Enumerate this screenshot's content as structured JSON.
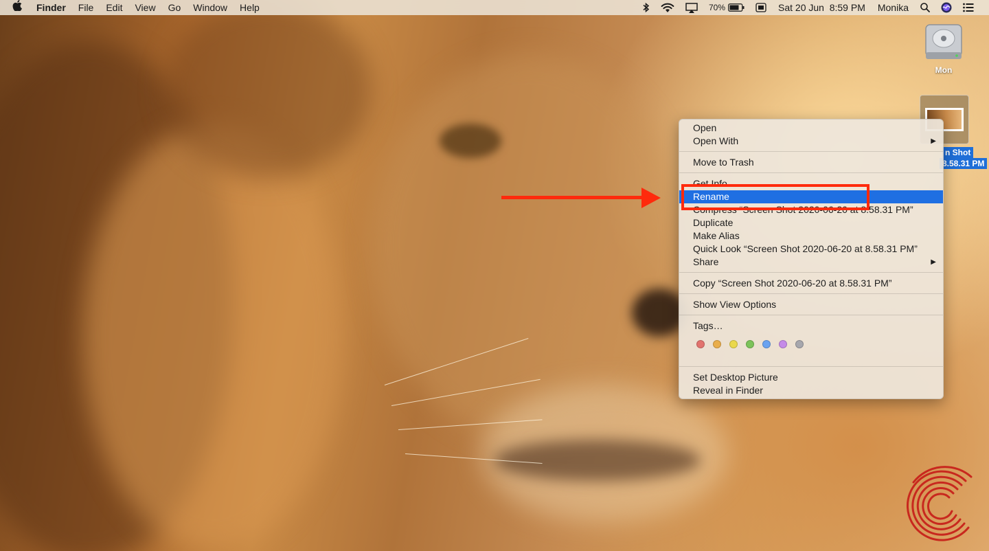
{
  "menubar": {
    "apple_glyph": "",
    "app_name": "Finder",
    "menus": [
      "File",
      "Edit",
      "View",
      "Go",
      "Window",
      "Help"
    ],
    "battery_percent": "70%",
    "datetime": "Sat 20 Jun  8:59 PM",
    "user": "Monika",
    "status_icons": [
      "bluetooth-icon",
      "wifi-icon",
      "airplay-icon",
      "battery-icon",
      "keyboard-icon",
      "spotlight-icon",
      "siri-icon",
      "notification-center-icon"
    ]
  },
  "desktop": {
    "drive_label": "Mon",
    "screenshot_label_line1": "n Shot",
    "screenshot_label_line2": "8.58.31 PM"
  },
  "context_menu": {
    "items": [
      {
        "label": "Open"
      },
      {
        "label": "Open With",
        "submenu": true
      },
      {
        "label": "Move to Trash"
      },
      {
        "label": "Get Info"
      },
      {
        "label": "Rename",
        "selected": true
      },
      {
        "label": "Compress “Screen Shot 2020-06-20 at 8.58.31 PM”"
      },
      {
        "label": "Duplicate"
      },
      {
        "label": "Make Alias"
      },
      {
        "label": "Quick Look “Screen Shot 2020-06-20 at 8.58.31 PM”"
      },
      {
        "label": "Share",
        "submenu": true
      },
      {
        "label": "Copy “Screen Shot 2020-06-20 at 8.58.31 PM”"
      },
      {
        "label": "Show View Options"
      },
      {
        "label": "Tags…"
      },
      {
        "label": "Set Desktop Picture"
      },
      {
        "label": "Reveal in Finder"
      }
    ],
    "submenu_glyph": "▶",
    "tag_colors": [
      "#e2736e",
      "#e9ad4a",
      "#ead84b",
      "#7cc35a",
      "#6aa3f0",
      "#c58be8",
      "#a7a7ad"
    ]
  },
  "colors": {
    "selection": "#1f6fe2",
    "annotation": "#ff2a0c"
  }
}
